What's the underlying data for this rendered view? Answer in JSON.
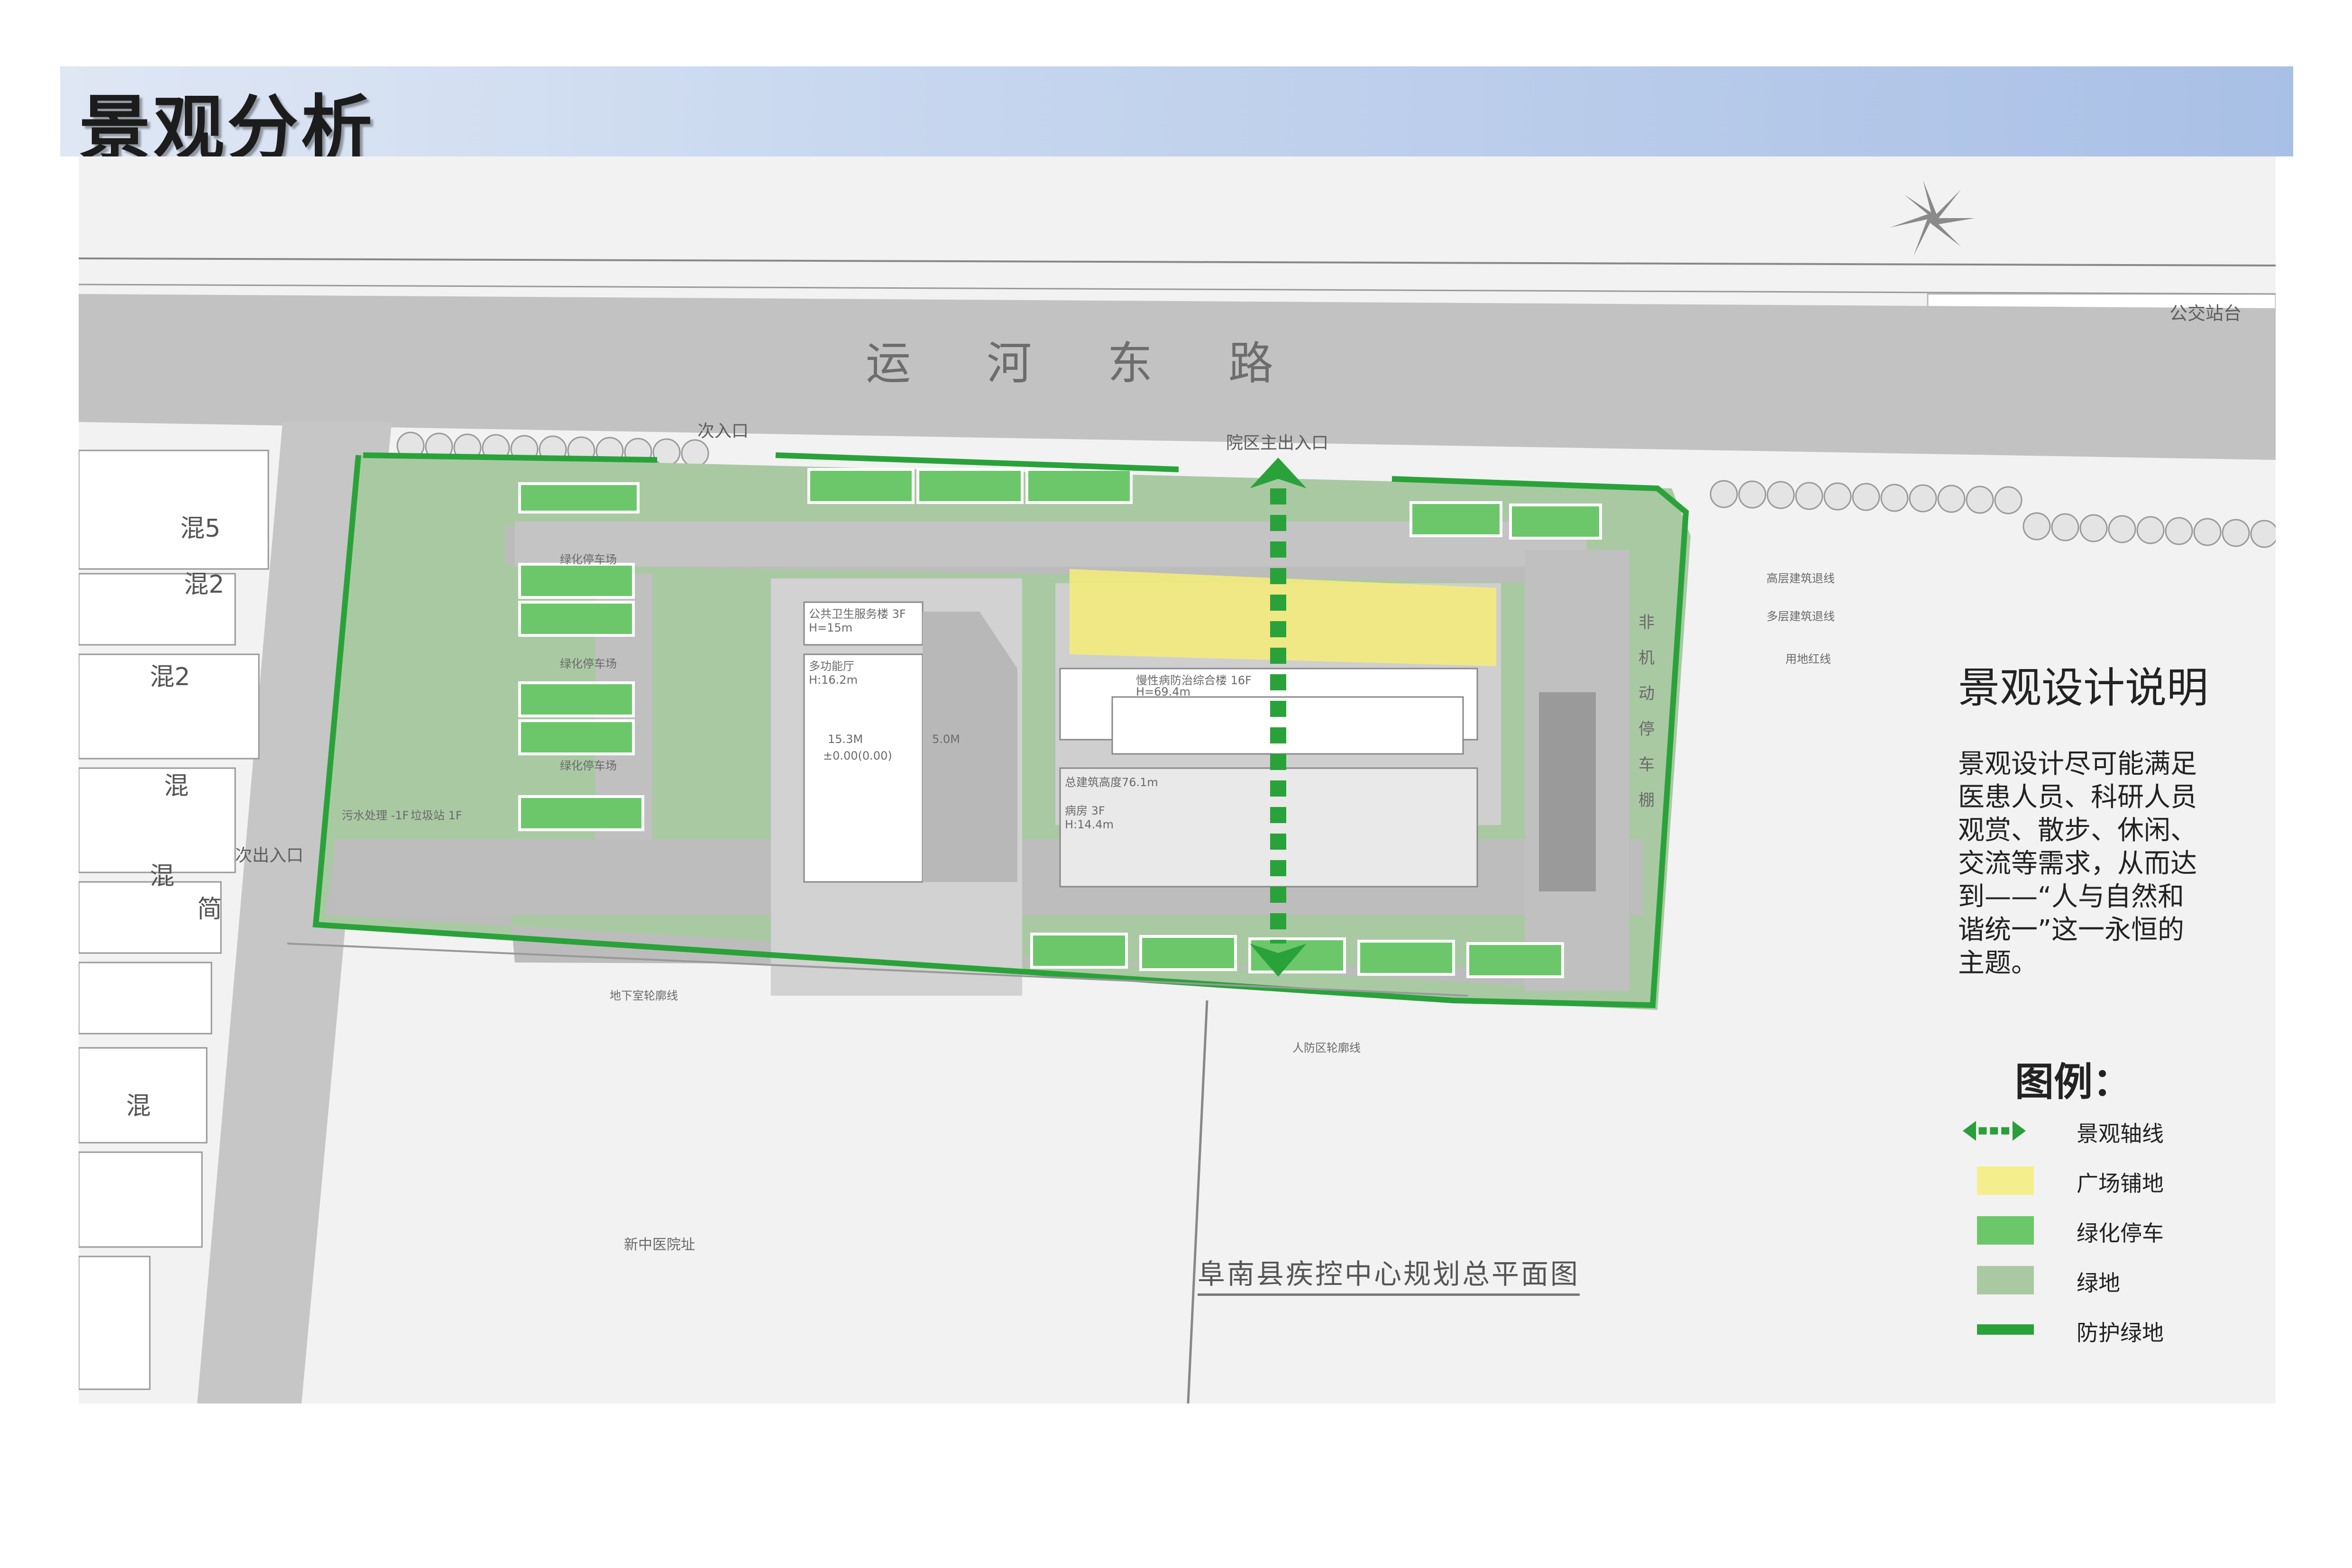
{
  "header": {
    "title": "景观分析"
  },
  "map": {
    "road_name": "运河东路",
    "bus_stop": "公交站台",
    "gates": {
      "main_gate": "院区主出入口",
      "secondary_gate_top": "次入口",
      "secondary_gate_left": "次出入口"
    },
    "buildings": {
      "public_health": "公共卫生服务楼 3F",
      "public_health_h": "H=15m",
      "multi_hall": "多功能厅",
      "multi_hall_h": "H:16.2m",
      "chronic": "慢性病防治综合楼 16F",
      "chronic_h": "H=69.4m",
      "total_height": "总建筑高度76.1m",
      "ward": "病房 3F",
      "ward_h": "H:14.4m",
      "sewage": "污水处理 -1F",
      "garbage": "垃圾站 1F"
    },
    "parking_labels": [
      "绿化停车场",
      "绿化停车场",
      "绿化停车场"
    ],
    "elevations": [
      "±0.00(0.00)",
      "15.3M",
      "5.0M"
    ],
    "old_site": "新中医院址",
    "neighbors": [
      "混5",
      "混2",
      "混2",
      "混",
      "混",
      "简",
      "混"
    ],
    "side_road_chars": [
      "非",
      "机",
      "动",
      "停",
      "车",
      "棚"
    ],
    "notes": [
      "高层建筑退线",
      "多层建筑退线",
      "用地红线",
      "地下室轮廓线",
      "人防区轮廓线"
    ],
    "caption": "阜南县疾控中心规划总平面图"
  },
  "description": {
    "title": "景观设计说明",
    "body": [
      "景观设计尽可能满足",
      "医患人员、科研人员",
      "观赏、散步、休闲、",
      "交流等需求，从而达",
      "到——“人与自然和",
      "谐统一”这一永恒的",
      "主题。"
    ]
  },
  "legend": {
    "title": "图例：",
    "items": [
      {
        "label": "景观轴线",
        "symbol": "axis",
        "color": "#2a9e3a"
      },
      {
        "label": "广场铺地",
        "symbol": "fill",
        "color": "#f5ee8c"
      },
      {
        "label": "绿化停车",
        "symbol": "fill",
        "color": "#6cc76a"
      },
      {
        "label": "绿地",
        "symbol": "fill",
        "color": "#a9c9a3"
      },
      {
        "label": "防护绿地",
        "symbol": "line",
        "color": "#2aa23a"
      }
    ]
  }
}
